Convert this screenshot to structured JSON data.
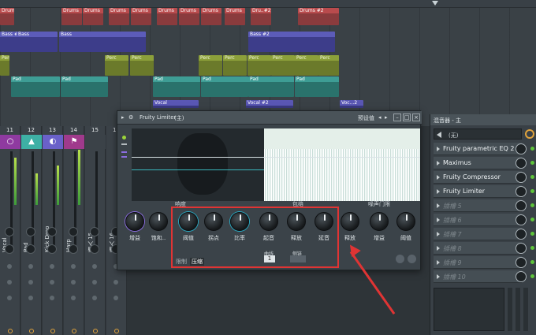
{
  "playlist": {
    "rows": [
      {
        "clips": [
          {
            "label": "Drums",
            "type": "drums"
          },
          {
            "label": "Drums",
            "type": "drums"
          },
          {
            "label": "Drums",
            "type": "drums"
          },
          {
            "label": "Drums",
            "type": "drums"
          },
          {
            "label": "Drums",
            "type": "drums"
          },
          {
            "label": "Drums",
            "type": "drums"
          },
          {
            "label": "Drums",
            "type": "drums"
          },
          {
            "label": "Drums",
            "type": "drums"
          },
          {
            "label": "Drums",
            "type": "drums"
          },
          {
            "label": "Dru..#2",
            "type": "drums"
          },
          {
            "label": "Drums #2",
            "type": "drums"
          }
        ]
      },
      {
        "clips": [
          {
            "label": "Bass #2",
            "type": "bass"
          },
          {
            "label": "Bass",
            "type": "bass"
          },
          {
            "label": "Bass",
            "type": "bass"
          },
          {
            "label": "Bass #2",
            "type": "bass"
          }
        ]
      },
      {
        "clips": [
          {
            "label": "Perc",
            "type": "perc"
          },
          {
            "label": "Perc",
            "type": "perc"
          },
          {
            "label": "Perc",
            "type": "perc"
          },
          {
            "label": "Perc",
            "type": "perc"
          },
          {
            "label": "Perc",
            "type": "perc"
          },
          {
            "label": "Perc",
            "type": "perc"
          },
          {
            "label": "Perc",
            "type": "perc"
          },
          {
            "label": "Perc",
            "type": "perc"
          },
          {
            "label": "Perc",
            "type": "perc"
          },
          {
            "label": "Perc",
            "type": "perc"
          }
        ]
      },
      {
        "clips": [
          {
            "label": "Pad",
            "type": "pad"
          },
          {
            "label": "Pad",
            "type": "pad"
          },
          {
            "label": "Pad",
            "type": "pad"
          },
          {
            "label": "Pad",
            "type": "pad"
          },
          {
            "label": "Pad",
            "type": "pad"
          },
          {
            "label": "Pad",
            "type": "pad"
          }
        ]
      },
      {
        "clips": [
          {
            "label": "Vocal",
            "type": "vocal"
          },
          {
            "label": "Vocal #2",
            "type": "vocal"
          },
          {
            "label": "Voc...2",
            "type": "vocal"
          }
        ]
      }
    ]
  },
  "mixer": {
    "strips": [
      {
        "num": "11",
        "name": "Vocal",
        "color": "#8f3aa0",
        "icon": "○"
      },
      {
        "num": "12",
        "name": "Pad",
        "color": "#3eb0a5",
        "icon": "▲"
      },
      {
        "num": "13",
        "name": "Kick Drop",
        "color": "#6a61c9",
        "icon": "◐"
      },
      {
        "num": "14",
        "name": "Harp",
        "color": "#a03a8c",
        "icon": "⚑"
      },
      {
        "num": "15",
        "name": "插入 15",
        "color": "#3b4248",
        "icon": ""
      },
      {
        "num": "16",
        "name": "插入 16",
        "color": "#3b4248",
        "icon": ""
      }
    ]
  },
  "plugin": {
    "title": "Fruity Limiter",
    "title_suffix": "(主)",
    "preset_label": "预设值",
    "controls_a": [
      "增益",
      "饱和.."
    ],
    "controls_b": [
      "阈值",
      "拐点",
      "比率",
      "起音",
      "释放",
      "延音"
    ],
    "controls_c": [
      "释放",
      "增益",
      "阈值"
    ],
    "section_labels": [
      "响度",
      "包络",
      "噪声门限"
    ],
    "curve_label": "曲线",
    "curve_value": "1",
    "sidechain_label": "侧链",
    "mode_tabs": [
      "限制",
      "压缩"
    ]
  },
  "fx_panel": {
    "title": "混音器 - 主",
    "routing_value": "(无)",
    "slots": [
      {
        "label": "Fruity parametric EQ 2",
        "empty": false
      },
      {
        "label": "Maximus",
        "empty": false
      },
      {
        "label": "Fruity Compressor",
        "empty": false
      },
      {
        "label": "Fruity Limiter",
        "empty": false
      },
      {
        "label": "插槽 5",
        "empty": true
      },
      {
        "label": "插槽 6",
        "empty": true
      },
      {
        "label": "插槽 7",
        "empty": true
      },
      {
        "label": "插槽 8",
        "empty": true
      },
      {
        "label": "插槽 9",
        "empty": true
      },
      {
        "label": "插槽 10",
        "empty": true
      }
    ]
  },
  "colors": {
    "highlight": "#e03434",
    "accent_teal": "#2aa9c2"
  }
}
